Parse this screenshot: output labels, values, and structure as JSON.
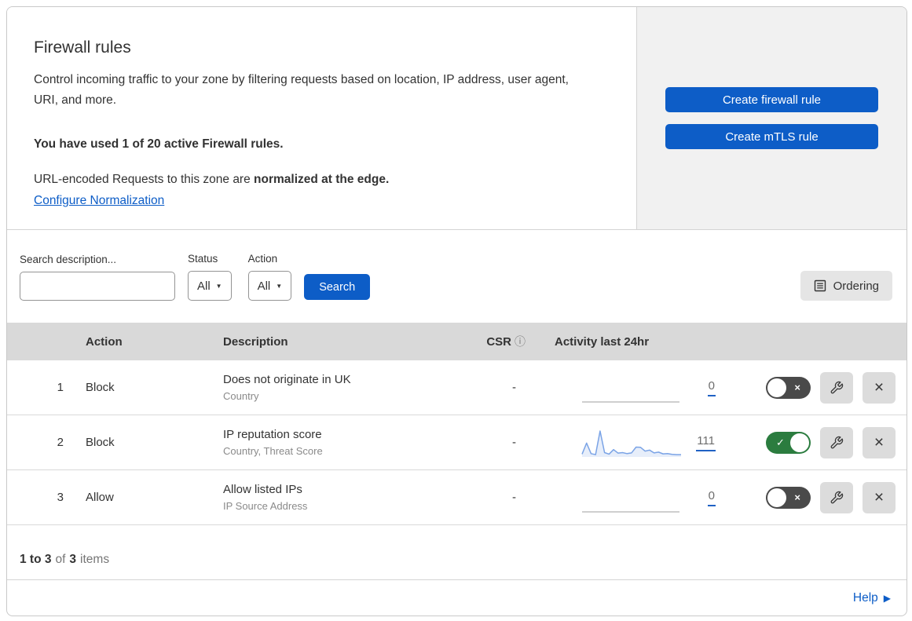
{
  "header": {
    "title": "Firewall rules",
    "description": "Control incoming traffic to your zone by filtering requests based on location, IP address, user agent, URI, and more.",
    "usage_line": "You have used 1 of 20 active Firewall rules.",
    "normalization_text": "URL-encoded Requests to this zone are ",
    "normalization_bold": "normalized at the edge.",
    "normalization_link": "Configure Normalization",
    "create_firewall_button": "Create firewall rule",
    "create_mtls_button": "Create mTLS rule"
  },
  "filters": {
    "search_label": "Search description...",
    "status_label": "Status",
    "status_value": "All",
    "action_label": "Action",
    "action_value": "All",
    "search_button": "Search",
    "ordering_button": "Ordering"
  },
  "table": {
    "columns": {
      "action": "Action",
      "description": "Description",
      "csr": "CSR",
      "csr_info": "ⓘ",
      "activity": "Activity last 24hr"
    },
    "rows": [
      {
        "priority": "1",
        "action": "Block",
        "description": "Does not originate in UK",
        "fields": "Country",
        "csr": "-",
        "count": "0",
        "enabled": false,
        "sparkline": []
      },
      {
        "priority": "2",
        "action": "Block",
        "description": "IP reputation score",
        "fields": "Country, Threat Score",
        "csr": "-",
        "count": "111",
        "enabled": true,
        "sparkline": [
          8,
          52,
          10,
          6,
          100,
          14,
          8,
          26,
          12,
          14,
          10,
          13,
          36,
          35,
          20,
          24,
          13,
          16,
          9,
          10,
          7,
          6,
          6
        ]
      },
      {
        "priority": "3",
        "action": "Allow",
        "description": "Allow listed IPs",
        "fields": "IP Source Address",
        "csr": "-",
        "count": "0",
        "enabled": false,
        "sparkline": []
      }
    ]
  },
  "footer": {
    "range_bold": "1 to 3",
    "of_text": "of",
    "total_bold": "3",
    "items_text": "items",
    "help_label": "Help"
  },
  "colors": {
    "accent_blue": "#0d5dc7",
    "panel_gray": "#f1f1f1",
    "table_header_gray": "#d9d9d9",
    "toggle_on_green": "#2b7c3f",
    "toggle_off_gray": "#4a4a4a",
    "sparkline_blue": "#7aa3e6",
    "count_underline_blue": "#2062c4"
  }
}
